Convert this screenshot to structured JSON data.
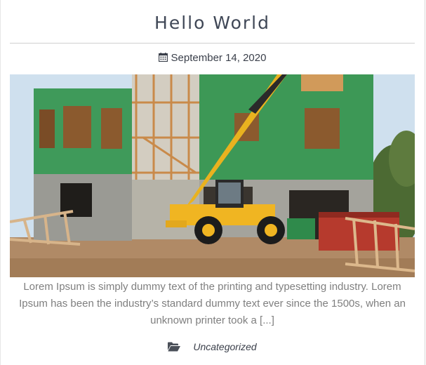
{
  "post": {
    "title": "Hello World",
    "date": "September 14, 2020",
    "excerpt": "Lorem Ipsum is simply dummy text of the printing and typesetting industry. Lorem Ipsum has been the industry’s standard dummy text ever since the 1500s, when an unknown printer took a [...]",
    "category": "Uncategorized"
  },
  "icons": {
    "date": "calendar-icon",
    "category": "folder-open-icon"
  },
  "colors": {
    "title": "#3f4756",
    "text_muted": "#7f7f7f",
    "meta": "#3a3f4a"
  }
}
